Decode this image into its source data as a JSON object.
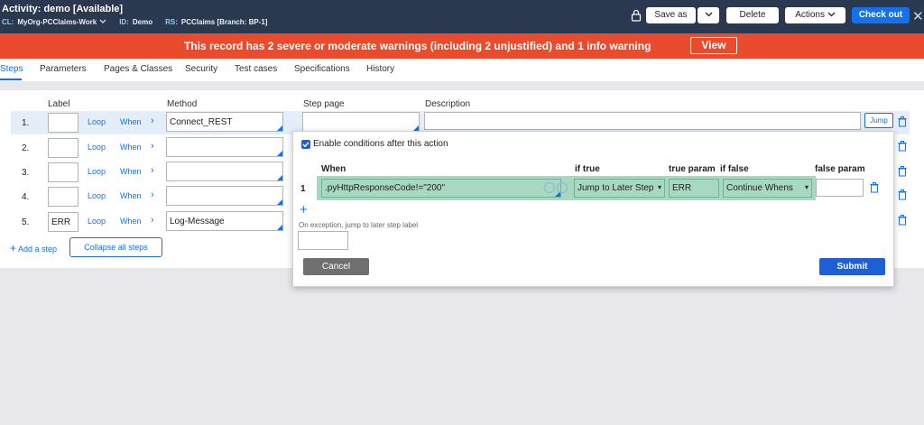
{
  "header": {
    "title": "Activity: demo [Available]",
    "cl_key": "CL:",
    "cl_value": "MyOrg-PCClaims-Work",
    "id_key": "ID:",
    "id_value": "Demo",
    "rs_key": "RS:",
    "rs_value": "PCClaims [Branch: BP-1]",
    "save_as_label": "Save as",
    "delete_label": "Delete",
    "actions_label": "Actions",
    "checkout_label": "Check out",
    "close_glyph": "✕"
  },
  "warning": {
    "text": "This record has 2 severe or moderate warnings (including 2 unjustified) and 1 info warning",
    "view_label": "View"
  },
  "tabs": [
    {
      "label": "Steps",
      "active": true
    },
    {
      "label": "Parameters"
    },
    {
      "label": "Pages & Classes"
    },
    {
      "label": "Security"
    },
    {
      "label": "Test cases"
    },
    {
      "label": "Specifications"
    },
    {
      "label": "History"
    }
  ],
  "steps": {
    "columns": {
      "label": "Label",
      "method": "Method",
      "step_page": "Step page",
      "description": "Description"
    },
    "loop_label": "Loop",
    "when_label": "When",
    "jump_label": "Jump",
    "rows": [
      {
        "num": "1.",
        "label": "",
        "method": "Connect_REST"
      },
      {
        "num": "2.",
        "label": "",
        "method": ""
      },
      {
        "num": "3.",
        "label": "",
        "method": ""
      },
      {
        "num": "4.",
        "label": "",
        "method": ""
      },
      {
        "num": "5.",
        "label": "ERR",
        "method": "Log-Message"
      }
    ],
    "add_step_label": "Add a step",
    "collapse_label": "Collapse all steps"
  },
  "popup": {
    "enable_label": "Enable conditions after this action",
    "headers": {
      "when": "When",
      "if_true": "if true",
      "true_param": "true param",
      "if_false": "if false",
      "false_param": "false param"
    },
    "row": {
      "num": "1",
      "when": ".pyHttpResponseCode!=\"200\"",
      "if_true": "Jump to Later Step",
      "true_param": "ERR",
      "if_false": "Continue Whens",
      "false_param": ""
    },
    "exception_label": "On exception, jump to later step label",
    "cancel_label": "Cancel",
    "submit_label": "Submit"
  },
  "colors": {
    "header_bg": "#2a3950",
    "warning_bg": "#ea4b2c",
    "accent": "#1570ec",
    "condition_bg": "#a8d8c0"
  }
}
